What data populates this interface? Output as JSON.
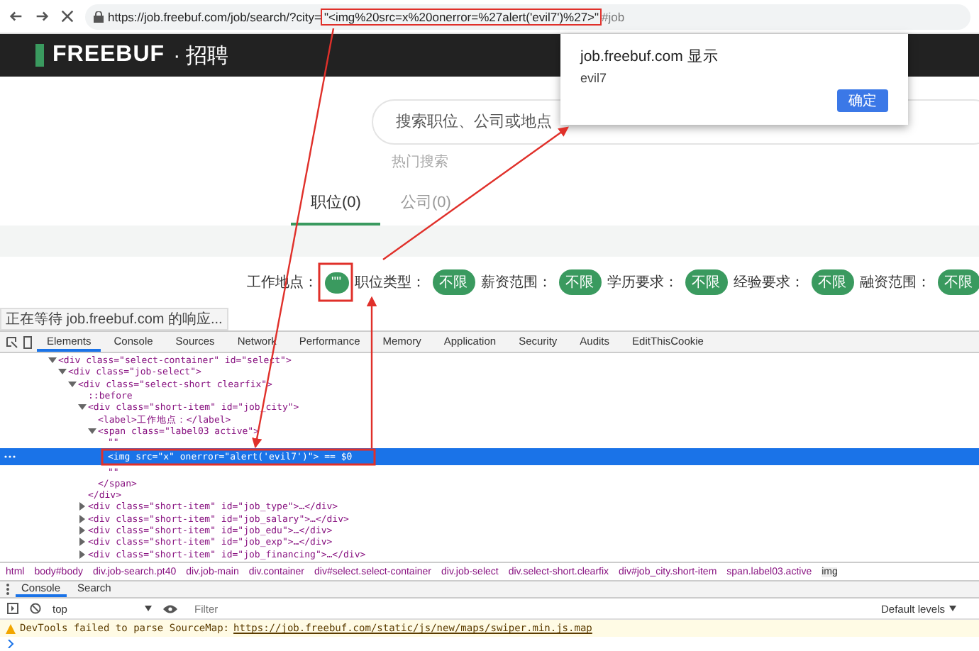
{
  "address_bar": {
    "url_prefix": "https://job.freebuf.com/job/search/?city=",
    "url_highlight": "\"<img%20src=x%20onerror=%27alert('evil7')%27>\"",
    "url_suffix": "#job"
  },
  "header": {
    "logo": "FREEBUF",
    "subtitle": "· 招聘"
  },
  "search": {
    "placeholder": "搜索职位、公司或地点",
    "hot_label": "热门搜索"
  },
  "result_tabs": [
    {
      "label": "职位(0)",
      "selected": true
    },
    {
      "label": "公司(0)",
      "selected": false
    }
  ],
  "filters": [
    {
      "label": "工作地点：",
      "value": "\"\""
    },
    {
      "label": "职位类型：",
      "value": "不限"
    },
    {
      "label": "薪资范围：",
      "value": "不限"
    },
    {
      "label": "学历要求：",
      "value": "不限"
    },
    {
      "label": "经验要求：",
      "value": "不限"
    },
    {
      "label": "融资范围：",
      "value": "不限"
    }
  ],
  "status_text": "正在等待 job.freebuf.com 的响应...",
  "alert": {
    "title": "job.freebuf.com 显示",
    "message": "evil7",
    "button": "确定"
  },
  "devtools_tabs": [
    {
      "label": "Elements",
      "selected": true
    },
    {
      "label": "Console",
      "selected": false
    },
    {
      "label": "Sources",
      "selected": false
    },
    {
      "label": "Network",
      "selected": false
    },
    {
      "label": "Performance",
      "selected": false
    },
    {
      "label": "Memory",
      "selected": false
    },
    {
      "label": "Application",
      "selected": false
    },
    {
      "label": "Security",
      "selected": false
    },
    {
      "label": "Audits",
      "selected": false
    },
    {
      "label": "EditThisCookie",
      "selected": false
    }
  ],
  "dom_tree": [
    {
      "text": "<div class=\"select-container\" id=\"select\">",
      "expanded": true,
      "selected": false,
      "children": [
        {
          "text": "<div class=\"job-select\">",
          "expanded": true,
          "selected": false,
          "children": [
            {
              "text": "<div class=\"select-short clearfix\">",
              "expanded": true,
              "selected": false,
              "children": [
                {
                  "text": "::before",
                  "selected": false
                },
                {
                  "text": "<div class=\"short-item\" id=\"job_city\">",
                  "expanded": true,
                  "selected": false,
                  "closing": "</div>",
                  "children": [
                    {
                      "text": "<label>工作地点：</label>",
                      "selected": false
                    },
                    {
                      "text": "<span class=\"label03 active\">",
                      "expanded": true,
                      "selected": false,
                      "closing": "</span>",
                      "children": [
                        {
                          "text": "\"\"",
                          "selected": false
                        },
                        {
                          "text": "<img src=\"x\" onerror=\"alert('evil7')\"> == $0",
                          "selected": true
                        },
                        {
                          "text": "\"\"",
                          "selected": false
                        }
                      ]
                    }
                  ]
                },
                {
                  "text": "<div class=\"short-item\" id=\"job_type\">…</div>",
                  "expanded": false,
                  "selected": false
                },
                {
                  "text": "<div class=\"short-item\" id=\"job_salary\">…</div>",
                  "expanded": false,
                  "selected": false
                },
                {
                  "text": "<div class=\"short-item\" id=\"job_edu\">…</div>",
                  "expanded": false,
                  "selected": false
                },
                {
                  "text": "<div class=\"short-item\" id=\"job_exp\">…</div>",
                  "expanded": false,
                  "selected": false
                },
                {
                  "text": "<div class=\"short-item\" id=\"job_financing\">…</div>",
                  "expanded": false,
                  "selected": false
                }
              ]
            }
          ]
        }
      ]
    }
  ],
  "breadcrumbs": [
    "html",
    "body#body",
    "div.job-search.pt40",
    "div.job-main",
    "div.container",
    "div#select.select-container",
    "div.job-select",
    "div.select-short.clearfix",
    "div#job_city.short-item",
    "span.label03.active",
    "img"
  ],
  "drawer_tabs": [
    {
      "label": "Console",
      "selected": true
    },
    {
      "label": "Search",
      "selected": false
    }
  ],
  "console_toolbar": {
    "context": "top",
    "filter_placeholder": "Filter",
    "levels": "Default levels"
  },
  "console_messages": [
    {
      "kind": "warning",
      "text": "DevTools failed to parse SourceMap: ",
      "link": "https://job.freebuf.com/static/js/new/maps/swiper.min.js.map"
    }
  ]
}
